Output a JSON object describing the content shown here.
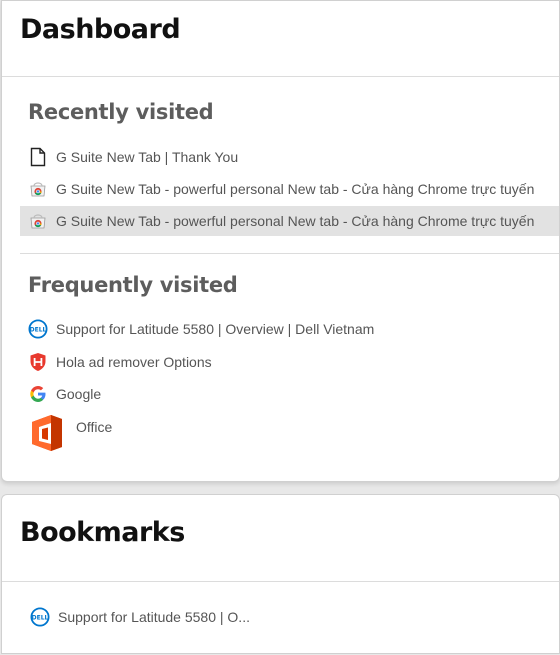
{
  "dashboard": {
    "title": "Dashboard",
    "recently_visited": {
      "title": "Recently visited",
      "items": [
        {
          "label": "G Suite New Tab | Thank You",
          "icon": "file-icon"
        },
        {
          "label": "G Suite New Tab - powerful personal New tab - Cửa hàng Chrome trực tuyến",
          "icon": "chrome-webstore-icon"
        },
        {
          "label": "G Suite New Tab - powerful personal New tab - Cửa hàng Chrome trực tuyến",
          "icon": "chrome-webstore-icon",
          "selected": true
        }
      ]
    },
    "frequently_visited": {
      "title": "Frequently visited",
      "items": [
        {
          "label": "Support for Latitude 5580 | Overview | Dell Vietnam",
          "icon": "dell-icon"
        },
        {
          "label": "Hola ad remover Options",
          "icon": "hola-shield-icon"
        },
        {
          "label": "Google",
          "icon": "google-icon"
        },
        {
          "label": "Office",
          "icon": "office-icon"
        }
      ]
    }
  },
  "bookmarks": {
    "title": "Bookmarks",
    "items": [
      {
        "label": "Support for Latitude 5580 | O...",
        "icon": "dell-icon"
      }
    ]
  },
  "colors": {
    "dell_blue": "#0076ce",
    "hola_red": "#e8392e",
    "office_orange": "#eb3c00",
    "selected_bg": "#e2e2e2"
  }
}
